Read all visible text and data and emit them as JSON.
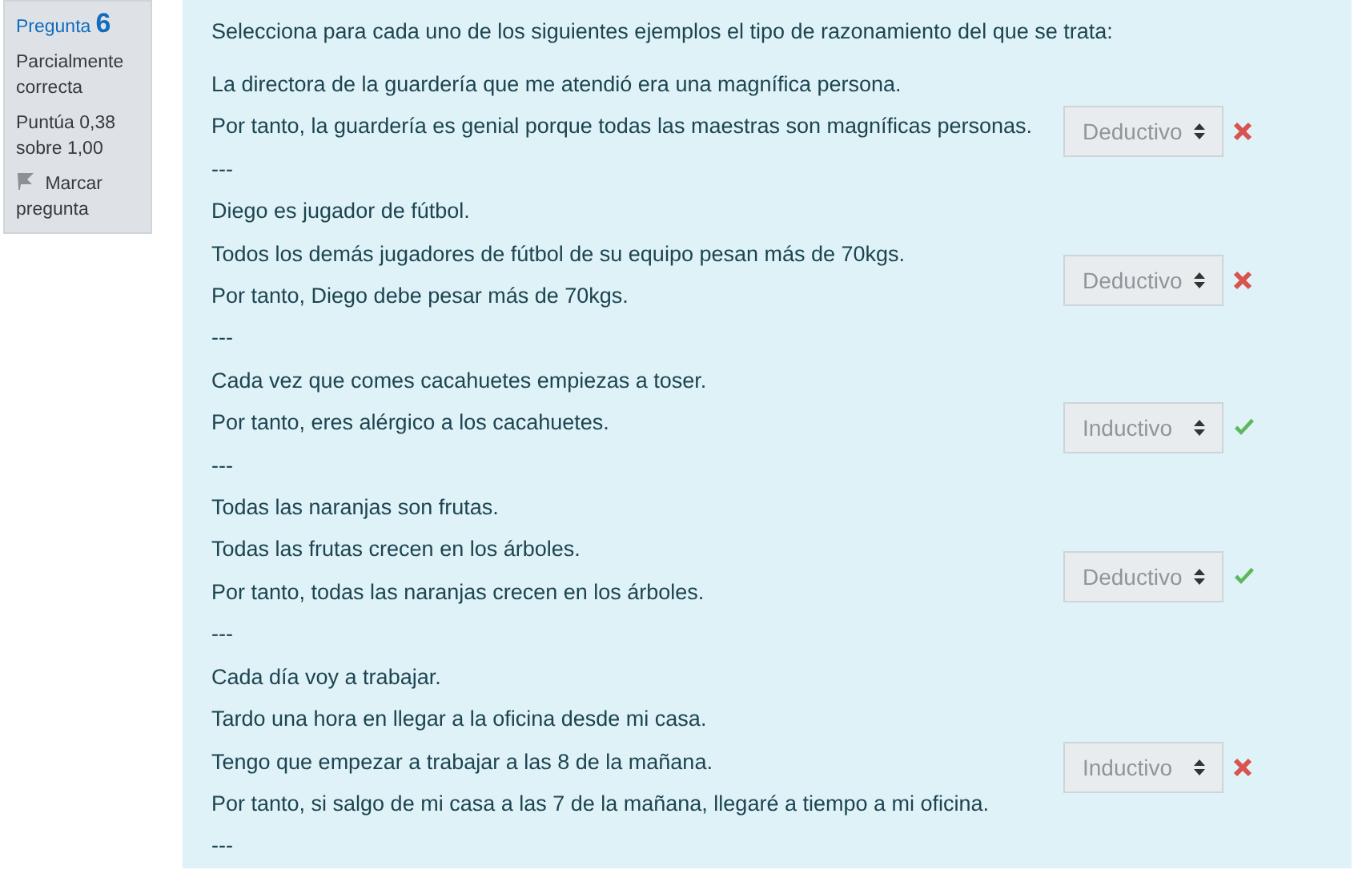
{
  "info": {
    "label": "Pregunta",
    "number": "6",
    "state": "Parcialmente correcta",
    "grade": "Puntúa 0,38 sobre 1,00",
    "flag": "Marcar pregunta"
  },
  "prompt": "Selecciona para cada uno de los siguientes ejemplos el tipo de razonamiento del que se trata:",
  "items": [
    {
      "lines": [
        "La directora de la guardería que me atendió era una magnífica persona.",
        "Por tanto, la guardería es genial porque todas las maestras son magníficas personas."
      ],
      "answer": "Deductivo",
      "correct": false,
      "separator": "---"
    },
    {
      "lines": [
        "Diego es jugador de fútbol.",
        "Todos los demás jugadores de fútbol de su equipo pesan más de 70kgs.",
        "Por tanto, Diego debe pesar más de 70kgs."
      ],
      "answer": "Deductivo",
      "correct": false,
      "separator": "---"
    },
    {
      "lines": [
        "Cada vez que comes cacahuetes empiezas a toser.",
        "Por tanto, eres alérgico a los cacahuetes."
      ],
      "answer": "Inductivo",
      "correct": true,
      "separator": "---"
    },
    {
      "lines": [
        "Todas las naranjas son frutas.",
        "Todas las frutas crecen en los árboles.",
        "Por tanto, todas las naranjas crecen en los árboles."
      ],
      "answer": "Deductivo",
      "correct": true,
      "separator": "---"
    },
    {
      "lines": [
        "Cada día voy a trabajar.",
        "Tardo una hora en llegar a la oficina desde mi casa.",
        "Tengo que empezar a trabajar a las 8 de la mañana.",
        "Por tanto, si salgo de mi casa a las 7 de la mañana, llegaré a tiempo a mi oficina."
      ],
      "answer": "Inductivo",
      "correct": false,
      "separator": "---"
    }
  ]
}
